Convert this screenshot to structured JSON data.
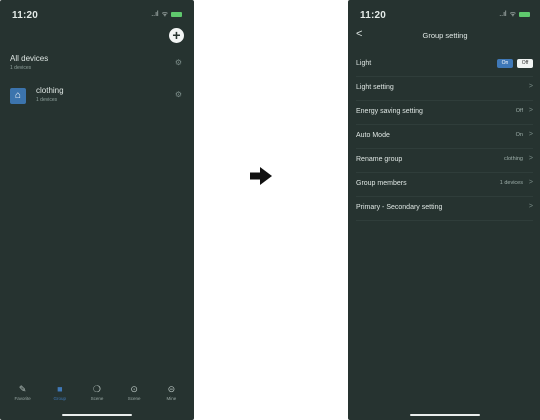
{
  "left": {
    "status": {
      "time": "11:20",
      "signal": "..ıl",
      "wifi": "ᯤ"
    },
    "add_label": "+",
    "all_devices": {
      "title": "All devices",
      "sub": "1 devices"
    },
    "group": {
      "title": "clothing",
      "sub": "1 devices"
    },
    "tabs": [
      {
        "icon": "✎",
        "label": "Favorite",
        "active": false
      },
      {
        "icon": "■",
        "label": "Group",
        "active": true
      },
      {
        "icon": "❍",
        "label": "Scene",
        "active": false
      },
      {
        "icon": "⊙",
        "label": "Scene",
        "active": false
      },
      {
        "icon": "⊝",
        "label": "Mine",
        "active": false
      }
    ]
  },
  "right": {
    "status": {
      "time": "11:20",
      "signal": "..ıl",
      "wifi": "ᯤ"
    },
    "back_label": "<",
    "title": "Group setting",
    "settings": [
      {
        "label": "Light",
        "type": "toggle",
        "on": "On",
        "off": "Off"
      },
      {
        "label": "Light setting",
        "value": "",
        "chevron": ">"
      },
      {
        "label": "Energy saving setting",
        "value": "Off",
        "chevron": ">"
      },
      {
        "label": "Auto Mode",
        "value": "On",
        "chevron": ">"
      },
      {
        "label": "Rename group",
        "value": "clothing",
        "chevron": ">"
      },
      {
        "label": "Group members",
        "value": "1 devices",
        "chevron": ">"
      },
      {
        "label": "Primary - Secondary setting",
        "value": "",
        "chevron": ">"
      }
    ]
  },
  "arrow_label": "➔",
  "colors": {
    "phone_bg": "#263330",
    "accent": "#3f78b7",
    "text": "#dfe7e4",
    "battery": "#5fc86d"
  }
}
